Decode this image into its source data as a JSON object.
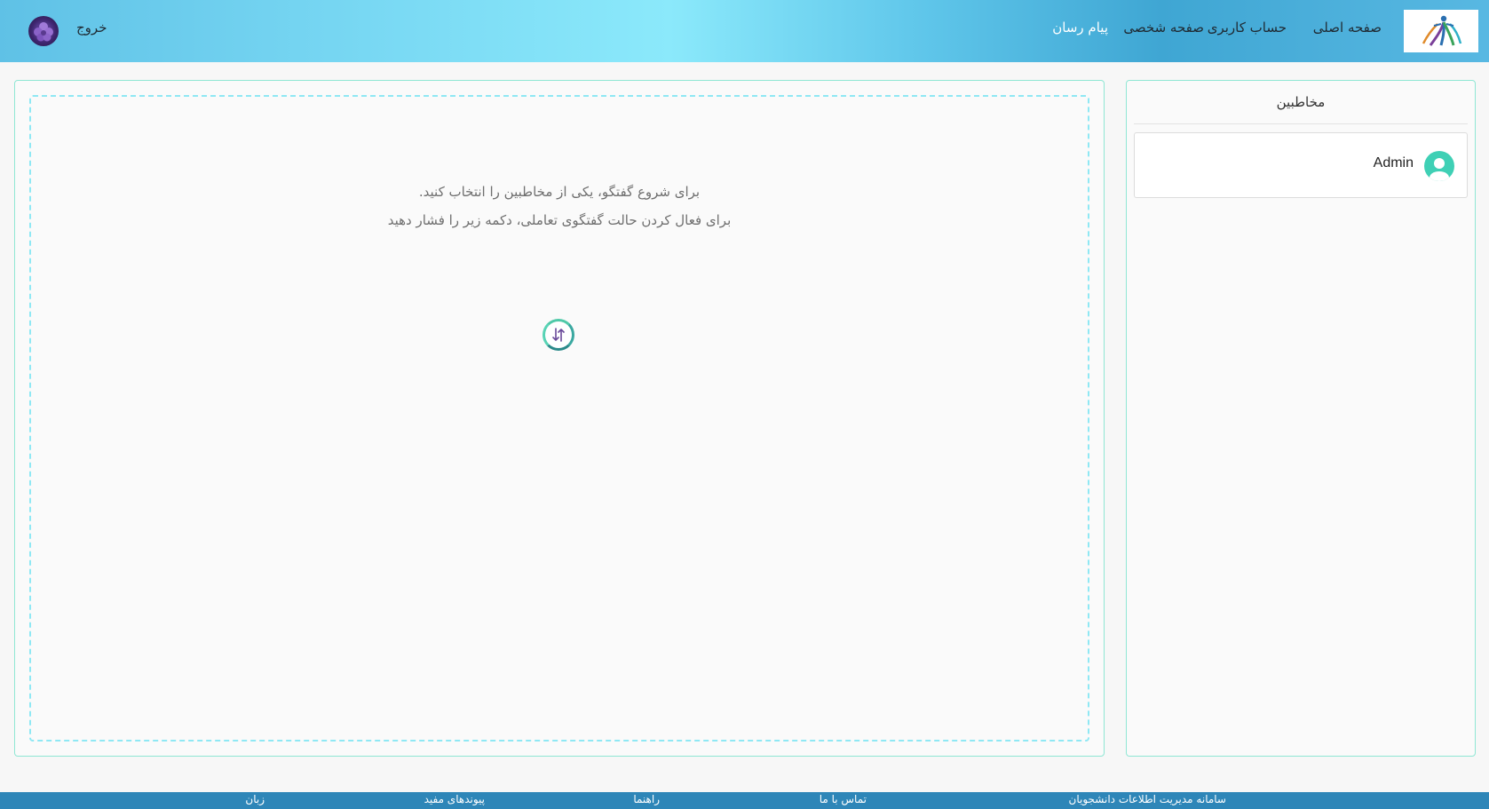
{
  "header": {
    "nav": {
      "home": "صفحه اصلی",
      "account": "حساب کاربری",
      "profile": "صفحه شخصی",
      "messenger": "پیام رسان"
    },
    "logout": "خروج"
  },
  "chat": {
    "line1": "برای شروع گفتگو، یکی از مخاطبین را انتخاب کنید.",
    "line2": "برای فعال کردن حالت گفتگوی تعاملی، دکمه زیر را فشار دهید"
  },
  "contacts": {
    "title": "مخاطبین",
    "items": [
      {
        "name": "Admin"
      }
    ]
  },
  "footer": {
    "system": "سامانه مدیریت اطلاعات دانشجویان",
    "contact": "تماس با ما",
    "guide": "راهنما",
    "links": "پیوندهای مفید",
    "language": "زبان"
  },
  "colors": {
    "accent": "#3fd0b5",
    "border": "#8fe7d4",
    "footer": "#2e86b8"
  }
}
